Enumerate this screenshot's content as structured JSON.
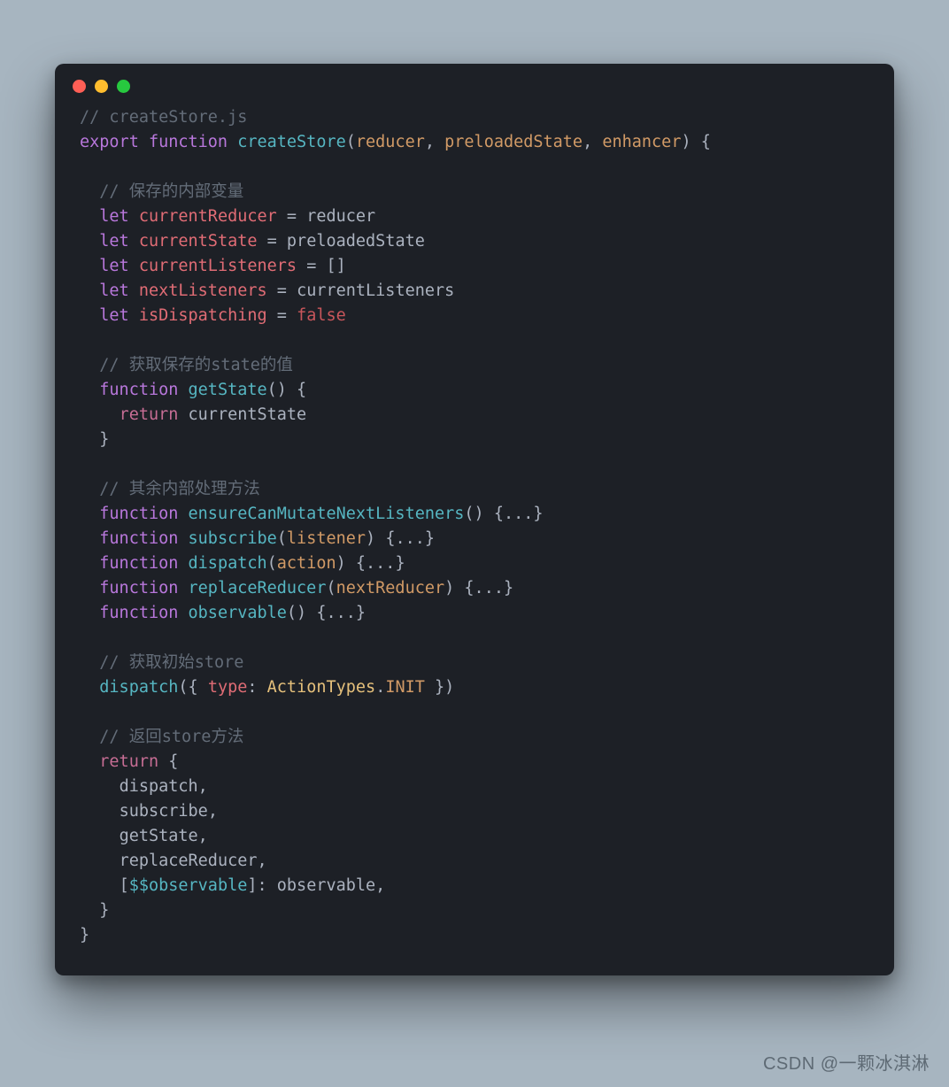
{
  "window": {
    "traffic_lights": [
      "red",
      "yellow",
      "green"
    ]
  },
  "code": {
    "c1": "// createStore.js",
    "kw_export": "export",
    "kw_function": "function",
    "fn_createStore": "createStore",
    "p_reducer": "reducer",
    "p_preloadedState": "preloadedState",
    "p_enhancer": "enhancer",
    "c2": "// 保存的内部变量",
    "kw_let": "let",
    "v_currentReducer": "currentReducer",
    "v_reducer": "reducer",
    "v_currentState": "currentState",
    "v_preloadedState": "preloadedState",
    "v_currentListeners": "currentListeners",
    "arr_empty": "[]",
    "v_nextListeners": "nextListeners",
    "v_isDispatching": "isDispatching",
    "lit_false": "false",
    "c3": "// 获取保存的state的值",
    "fn_getState": "getState",
    "kw_return": "return",
    "c4": "// 其余内部处理方法",
    "fn_ensure": "ensureCanMutateNextListeners",
    "fn_subscribe": "subscribe",
    "p_listener": "listener",
    "fn_dispatch": "dispatch",
    "p_action": "action",
    "fn_replaceReducer": "replaceReducer",
    "p_nextReducer": "nextReducer",
    "fn_observable": "observable",
    "body_ellipsis": "{...}",
    "c5": "// 获取初始store",
    "call_dispatch": "dispatch",
    "k_type": "type",
    "ActionTypes": "ActionTypes",
    "INIT": "INIT",
    "c6": "// 返回store方法",
    "ret_dispatch": "dispatch",
    "ret_subscribe": "subscribe",
    "ret_getState": "getState",
    "ret_replaceReducer": "replaceReducer",
    "ret_obsKey": "$$observable",
    "ret_obsVal": "observable"
  },
  "watermark": "CSDN @一颗冰淇淋"
}
